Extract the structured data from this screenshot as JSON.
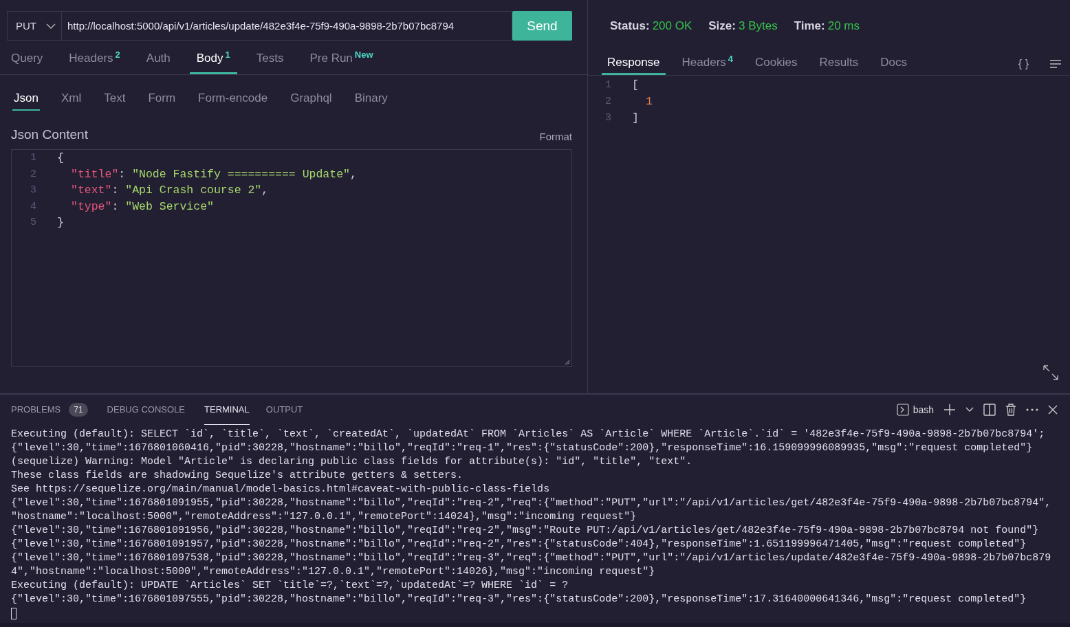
{
  "request": {
    "method": "PUT",
    "url": "http://localhost:5000/api/v1/articles/update/482e3f4e-75f9-490a-9898-2b7b07bc8794",
    "send_label": "Send"
  },
  "request_tabs": [
    {
      "label": "Query",
      "selected": false
    },
    {
      "label": "Headers",
      "badge": "2",
      "selected": false
    },
    {
      "label": "Auth",
      "selected": false
    },
    {
      "label": "Body",
      "badge": "1",
      "selected": true
    },
    {
      "label": "Tests",
      "selected": false
    },
    {
      "label": "Pre Run",
      "badge": "New",
      "selected": false
    }
  ],
  "body_tabs": [
    {
      "label": "Json",
      "selected": true
    },
    {
      "label": "Xml",
      "selected": false
    },
    {
      "label": "Text",
      "selected": false
    },
    {
      "label": "Form",
      "selected": false
    },
    {
      "label": "Form-encode",
      "selected": false
    },
    {
      "label": "Graphql",
      "selected": false
    },
    {
      "label": "Binary",
      "selected": false
    }
  ],
  "editor": {
    "title": "Json Content",
    "format_label": "Format",
    "lines": [
      {
        "number": "1",
        "kind": "brace",
        "tokens": [
          {
            "kind": "punct",
            "text": "{"
          }
        ]
      },
      {
        "number": "2",
        "kind": "member",
        "tokens": [
          {
            "kind": "key",
            "text": "\"title\""
          },
          {
            "kind": "punct",
            "text": ": "
          },
          {
            "kind": "string",
            "text": "\"Node Fastify ========== Update\""
          },
          {
            "kind": "punct",
            "text": ","
          }
        ]
      },
      {
        "number": "3",
        "kind": "member",
        "tokens": [
          {
            "kind": "key",
            "text": "\"text\""
          },
          {
            "kind": "punct",
            "text": ": "
          },
          {
            "kind": "string",
            "text": "\"Api Crash course 2\""
          },
          {
            "kind": "punct",
            "text": ","
          }
        ]
      },
      {
        "number": "4",
        "kind": "member",
        "tokens": [
          {
            "kind": "key",
            "text": "\"type\""
          },
          {
            "kind": "punct",
            "text": ": "
          },
          {
            "kind": "string",
            "text": "\"Web Service\""
          }
        ]
      },
      {
        "number": "5",
        "kind": "brace",
        "tokens": [
          {
            "kind": "punct",
            "text": "}"
          }
        ]
      }
    ]
  },
  "response_status": [
    {
      "label": "Status:",
      "value": "200 OK"
    },
    {
      "label": "Size:",
      "value": "3 Bytes"
    },
    {
      "label": "Time:",
      "value": "20 ms"
    }
  ],
  "response_tabs": [
    {
      "label": "Response",
      "selected": true
    },
    {
      "label": "Headers",
      "badge": "4",
      "selected": false
    },
    {
      "label": "Cookies",
      "selected": false
    },
    {
      "label": "Results",
      "selected": false
    },
    {
      "label": "Docs",
      "selected": false
    }
  ],
  "response_braces_label": "{ }",
  "response_lines": [
    {
      "number": "1",
      "kind": "brace",
      "tokens": [
        {
          "kind": "punct",
          "text": "["
        }
      ]
    },
    {
      "number": "2",
      "kind": "member",
      "tokens": [
        {
          "kind": "number",
          "text": "1"
        }
      ]
    },
    {
      "number": "3",
      "kind": "brace",
      "tokens": [
        {
          "kind": "punct",
          "text": "]"
        }
      ]
    }
  ],
  "panel_tabs": [
    {
      "label": "PROBLEMS",
      "badge": "71",
      "selected": false
    },
    {
      "label": "DEBUG CONSOLE",
      "selected": false
    },
    {
      "label": "TERMINAL",
      "selected": true
    },
    {
      "label": "OUTPUT",
      "selected": false
    }
  ],
  "terminal": {
    "shell": "bash",
    "lines": [
      "Executing (default): SELECT `id`, `title`, `text`, `createdAt`, `updatedAt` FROM `Articles` AS `Article` WHERE `Article`.`id` = '482e3f4e-75f9-490a-9898-2b7b07bc8794';",
      "{\"level\":30,\"time\":1676801060416,\"pid\":30228,\"hostname\":\"billo\",\"reqId\":\"req-1\",\"res\":{\"statusCode\":200},\"responseTime\":16.159099996089935,\"msg\":\"request completed\"}",
      "(sequelize) Warning: Model \"Article\" is declaring public class fields for attribute(s): \"id\", \"title\", \"text\".",
      "These class fields are shadowing Sequelize's attribute getters & setters.",
      "See https://sequelize.org/main/manual/model-basics.html#caveat-with-public-class-fields",
      "{\"level\":30,\"time\":1676801091955,\"pid\":30228,\"hostname\":\"billo\",\"reqId\":\"req-2\",\"req\":{\"method\":\"PUT\",\"url\":\"/api/v1/articles/get/482e3f4e-75f9-490a-9898-2b7b07bc8794\",",
      "\"hostname\":\"localhost:5000\",\"remoteAddress\":\"127.0.0.1\",\"remotePort\":14024},\"msg\":\"incoming request\"}",
      "{\"level\":30,\"time\":1676801091956,\"pid\":30228,\"hostname\":\"billo\",\"reqId\":\"req-2\",\"msg\":\"Route PUT:/api/v1/articles/get/482e3f4e-75f9-490a-9898-2b7b07bc8794 not found\"}",
      "{\"level\":30,\"time\":1676801091957,\"pid\":30228,\"hostname\":\"billo\",\"reqId\":\"req-2\",\"res\":{\"statusCode\":404},\"responseTime\":1.651199996471405,\"msg\":\"request completed\"}",
      "{\"level\":30,\"time\":1676801097538,\"pid\":30228,\"hostname\":\"billo\",\"reqId\":\"req-3\",\"req\":{\"method\":\"PUT\",\"url\":\"/api/v1/articles/update/482e3f4e-75f9-490a-9898-2b7b07bc879",
      "4\",\"hostname\":\"localhost:5000\",\"remoteAddress\":\"127.0.0.1\",\"remotePort\":14026},\"msg\":\"incoming request\"}",
      "Executing (default): UPDATE `Articles` SET `title`=?,`text`=?,`updatedAt`=? WHERE `id` = ?",
      "{\"level\":30,\"time\":1676801097555,\"pid\":30228,\"hostname\":\"billo\",\"reqId\":\"req-3\",\"res\":{\"statusCode\":200},\"responseTime\":17.31640000641346,\"msg\":\"request completed\"}"
    ]
  }
}
